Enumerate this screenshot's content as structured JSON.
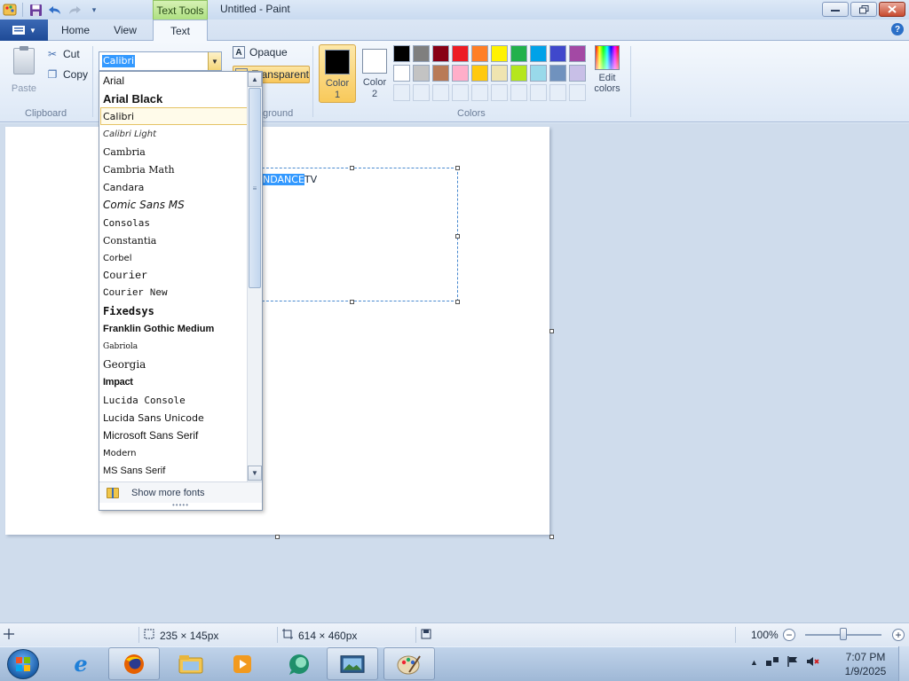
{
  "window": {
    "title": "Untitled - Paint",
    "contextual_tab": "Text Tools",
    "minimize": "▭",
    "restore": "❐",
    "close": "✕"
  },
  "quick_access": {
    "icons": [
      "paint-app-icon",
      "save-icon",
      "undo-icon",
      "redo-icon",
      "customize-qat-icon"
    ]
  },
  "tabs": {
    "app_menu": "▤▾",
    "home": "Home",
    "view": "View",
    "text": "Text",
    "active": "Text",
    "help": "?"
  },
  "clipboard": {
    "paste": "Paste",
    "cut": "Cut",
    "copy": "Copy",
    "group_label": "Clipboard"
  },
  "font": {
    "selected": "Calibri",
    "dropdown_fonts": [
      "Arial",
      "Arial Black",
      "Calibri",
      "Calibri Light",
      "Cambria",
      "Cambria Math",
      "Candara",
      "Comic Sans MS",
      "Consolas",
      "Constantia",
      "Corbel",
      "Courier",
      "Courier New",
      "Fixedsys",
      "Franklin Gothic Medium",
      "Gabriola",
      "Georgia",
      "Impact",
      "Lucida Console",
      "Lucida Sans Unicode",
      "Microsoft Sans Serif",
      "Modern",
      "MS Sans Serif"
    ],
    "show_more": "Show more fonts"
  },
  "background": {
    "opaque": "Opaque",
    "transparent": "Transparent",
    "group_label_visible": "ground"
  },
  "colors": {
    "color1_label": "Color\n1",
    "color1_line1": "Color",
    "color1_line2": "1",
    "color2_line1": "Color",
    "color2_line2": "2",
    "color1": "#000000",
    "color2": "#ffffff",
    "palette_row1": [
      "#000000",
      "#7f7f7f",
      "#880015",
      "#ed1c24",
      "#ff7f27",
      "#fff200",
      "#22b14c",
      "#00a2e8",
      "#3f48cc",
      "#a349a4"
    ],
    "palette_row2": [
      "#ffffff",
      "#c3c3c3",
      "#b97a57",
      "#ffaec9",
      "#ffc90e",
      "#efe4b0",
      "#b5e61d",
      "#99d9ea",
      "#7092be",
      "#c8bfe7"
    ],
    "edit_line1": "Edit",
    "edit_line2": "colors",
    "group_label": "Colors"
  },
  "canvas": {
    "text_selected": "NDANCE",
    "text_rest": "TV"
  },
  "status": {
    "selection_size": "235 × 145px",
    "canvas_size": "614 × 460px",
    "zoom": "100%"
  },
  "taskbar": {
    "apps": [
      "internet-explorer-icon",
      "firefox-icon",
      "file-explorer-icon",
      "media-player-icon",
      "chat-app-icon",
      "photo-viewer-icon",
      "paint-icon"
    ],
    "time": "7:07 PM",
    "date": "1/9/2025"
  }
}
